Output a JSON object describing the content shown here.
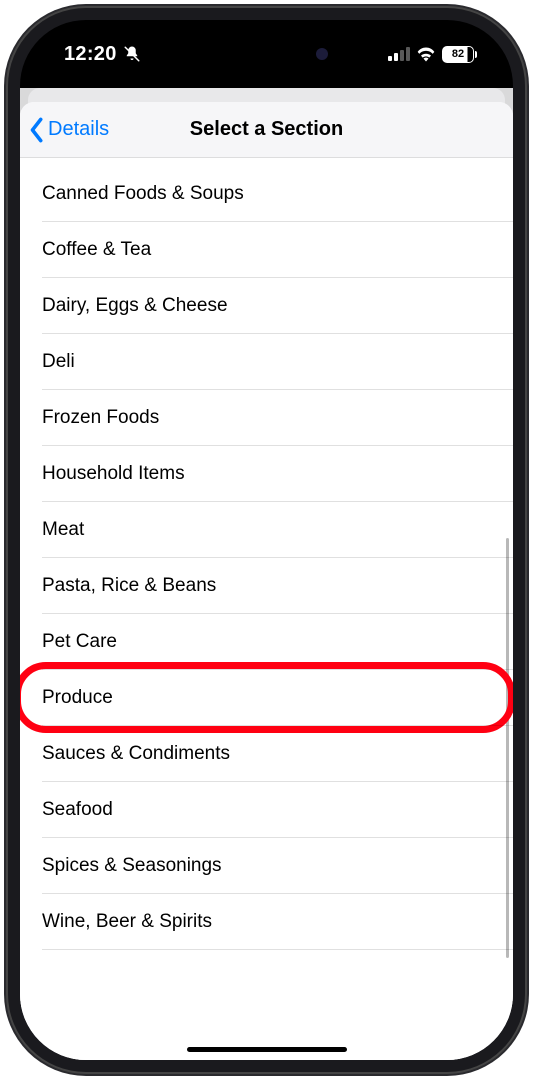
{
  "status": {
    "time": "12:20",
    "battery_pct": "82"
  },
  "nav": {
    "back_label": "Details",
    "title": "Select a Section"
  },
  "sections": [
    {
      "label": "Canned Foods & Soups"
    },
    {
      "label": "Coffee & Tea"
    },
    {
      "label": "Dairy, Eggs & Cheese"
    },
    {
      "label": "Deli"
    },
    {
      "label": "Frozen Foods"
    },
    {
      "label": "Household Items"
    },
    {
      "label": "Meat"
    },
    {
      "label": "Pasta, Rice & Beans"
    },
    {
      "label": "Pet Care"
    },
    {
      "label": "Produce",
      "highlighted": true
    },
    {
      "label": "Sauces & Condiments"
    },
    {
      "label": "Seafood"
    },
    {
      "label": "Spices & Seasonings"
    },
    {
      "label": "Wine, Beer & Spirits"
    }
  ]
}
